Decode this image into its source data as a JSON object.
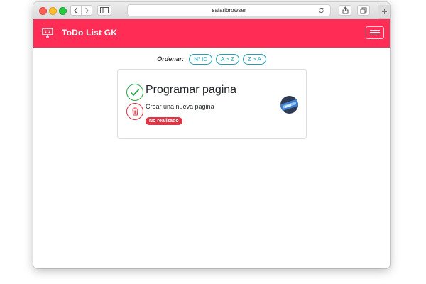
{
  "browser": {
    "address": "safaribrowser",
    "back_icon": "chevron-left-icon",
    "forward_icon": "chevron-right-icon",
    "sidebar_icon": "sidebar-icon",
    "reload_icon": "reload-icon",
    "share_icon": "share-icon",
    "tabs_icon": "tabs-icon",
    "newtab_icon": "plus-icon"
  },
  "navbar": {
    "brand": "ToDo List GK",
    "brand_icon": "monitor-code-icon",
    "menu_icon": "hamburger-icon",
    "background": "#ff2d55"
  },
  "sort": {
    "label": "Ordenar:",
    "buttons": [
      "N° iD",
      "A > Z",
      "Z > A"
    ],
    "accent": "#17a2b8"
  },
  "task": {
    "title": "Programar pagina",
    "description": "Crear una nueva pagina",
    "status": "No realizado",
    "status_color": "#dc3545",
    "complete_icon": "check-icon",
    "delete_icon": "trash-icon"
  }
}
